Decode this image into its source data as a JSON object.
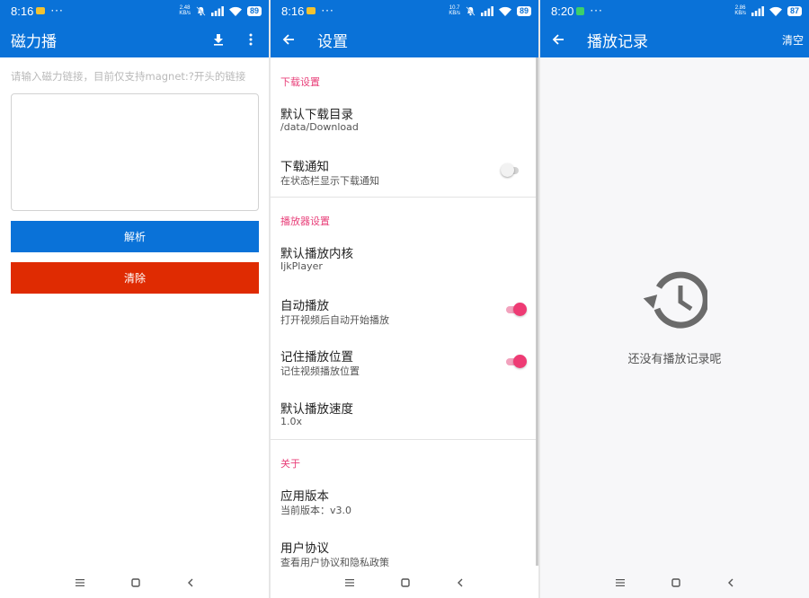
{
  "screens": [
    {
      "status": {
        "time": "8:16",
        "dots": "···",
        "net_speed_top": "2.48",
        "net_speed_bottom": "KB/s",
        "battery": "89"
      },
      "title": "磁力播",
      "icons": [
        "download-icon",
        "more-vert-icon"
      ],
      "input": {
        "hint": "请输入磁力链接，目前仅支持magnet:?开头的链接",
        "value": ""
      },
      "buttons": {
        "parse": "解析",
        "clear": "清除"
      }
    },
    {
      "status": {
        "time": "8:16",
        "dots": "···",
        "net_speed_top": "10.7",
        "net_speed_bottom": "KB/s",
        "battery": "89"
      },
      "title": "设置",
      "sections": [
        {
          "header": "下载设置",
          "items": [
            {
              "title": "默认下载目录",
              "subtitle": "/data/Download"
            },
            {
              "title": "下载通知",
              "subtitle": "在状态栏显示下载通知",
              "switch_on": false
            }
          ]
        },
        {
          "header": "播放器设置",
          "items": [
            {
              "title": "默认播放内核",
              "subtitle": "IjkPlayer"
            },
            {
              "title": "自动播放",
              "subtitle": "打开视频后自动开始播放",
              "switch_on": true
            },
            {
              "title": "记住播放位置",
              "subtitle": "记住视频播放位置",
              "switch_on": true
            },
            {
              "title": "默认播放速度",
              "subtitle": "1.0x"
            }
          ]
        },
        {
          "header": "关于",
          "items": [
            {
              "title": "应用版本",
              "subtitle": "当前版本：v3.0"
            },
            {
              "title": "用户协议",
              "subtitle": "查看用户协议和隐私政策"
            }
          ]
        }
      ]
    },
    {
      "status": {
        "time": "8:20",
        "dots": "···",
        "net_speed_top": "2.86",
        "net_speed_bottom": "KB/s",
        "battery": "87"
      },
      "title": "播放记录",
      "action": "清空",
      "empty_text": "还没有播放记录呢"
    }
  ],
  "colors": {
    "primary": "#0a72d8",
    "clear_button": "#df2b02",
    "accent": "#ee3b74",
    "section_header": "#e8407a"
  }
}
